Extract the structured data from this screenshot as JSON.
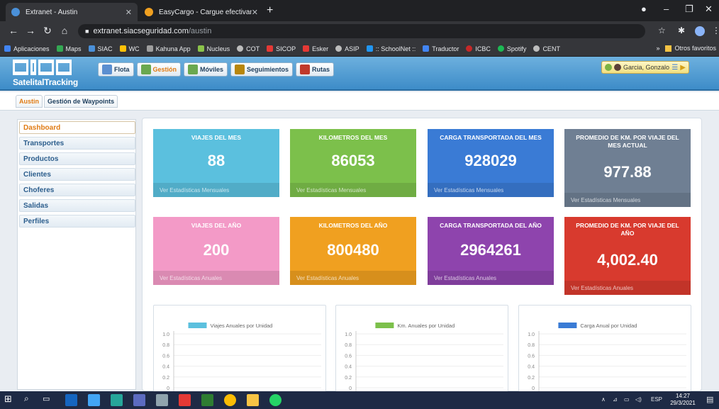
{
  "browser": {
    "tabs": [
      {
        "label": "Extranet - Austin",
        "active": true
      },
      {
        "label": "EasyCargo - Cargue efectivamen",
        "active": false
      }
    ],
    "url_host": "extranet.siacseguridad.com",
    "url_path": "/austin",
    "bookmarks": [
      "Aplicaciones",
      "Maps",
      "SIAC",
      "WC",
      "Kahuna App",
      "Nucleus",
      "COT",
      "SICOP",
      "Esker",
      "ASIP",
      ":: SchoolNet ::",
      "Traductor",
      "ICBC",
      "Spotify",
      "CENT"
    ],
    "bookmarks_more": "»",
    "other_bookmarks": "Otros favoritos"
  },
  "app": {
    "logo_tagline": "SatelitalTracking",
    "menu": [
      {
        "label": "Flota",
        "active": false,
        "color": "#5b8fd0"
      },
      {
        "label": "Gestión",
        "active": true,
        "color": "#6aa84f"
      },
      {
        "label": "Móviles",
        "active": false,
        "color": "#6aa84f"
      },
      {
        "label": "Seguimientos",
        "active": false,
        "color": "#b8860b"
      },
      {
        "label": "Rutas",
        "active": false,
        "color": "#c0392b"
      }
    ],
    "user_name": "Garcia, Gonzalo"
  },
  "subtabs": [
    {
      "label": "Austin",
      "active": true
    },
    {
      "label": "Gestión de Waypoints",
      "active": false
    }
  ],
  "sidebar": {
    "items": [
      {
        "label": "Dashboard",
        "active": true
      },
      {
        "label": "Transportes",
        "active": false
      },
      {
        "label": "Productos",
        "active": false
      },
      {
        "label": "Clientes",
        "active": false
      },
      {
        "label": "Choferes",
        "active": false
      },
      {
        "label": "Salidas",
        "active": false
      },
      {
        "label": "Perfiles",
        "active": false
      }
    ]
  },
  "cards": [
    {
      "title": "VIAJES DEL MES",
      "value": "88",
      "footer": "Ver Estadísticas Mensuales",
      "color": "#5bc0de"
    },
    {
      "title": "KILOMETROS DEL MES",
      "value": "86053",
      "footer": "Ver Estadísticas Mensuales",
      "color": "#7cc04b"
    },
    {
      "title": "CARGA TRANSPORTADA DEL MES",
      "value": "928029",
      "footer": "Ver Estadísticas Mensuales",
      "color": "#3a7bd5"
    },
    {
      "title": "PROMEDIO DE KM. POR VIAJE DEL MES ACTUAL",
      "value": "977.88",
      "footer": "Ver Estadísticas Mensuales",
      "color": "#6f7f93"
    },
    {
      "title": "VIAJES DEL AÑO",
      "value": "200",
      "footer": "Ver Estadísticas Anuales",
      "color": "#f39ac7"
    },
    {
      "title": "KILOMETROS DEL AÑO",
      "value": "800480",
      "footer": "Ver Estadísticas Anuales",
      "color": "#f0a020"
    },
    {
      "title": "CARGA TRANSPORTADA DEL AÑO",
      "value": "2964261",
      "footer": "Ver Estadísticas Anuales",
      "color": "#8e44ad"
    },
    {
      "title": "PROMEDIO DE KM. POR VIAJE DEL AÑO",
      "value": "4,002.40",
      "footer": "Ver Estadísticas Anuales",
      "color": "#d83a2e"
    }
  ],
  "chart_data": [
    {
      "type": "bar",
      "legend": "Viajes Anuales por Unidad",
      "color": "#5bc0de",
      "categories": [],
      "values": [],
      "yticks": [
        "1.0",
        "0.8",
        "0.6",
        "0.4",
        "0.2",
        "0"
      ],
      "ylim": [
        0,
        1.0
      ],
      "grid": true,
      "legend_position": "top"
    },
    {
      "type": "bar",
      "legend": "Km. Anuales por Unidad",
      "color": "#7cc04b",
      "categories": [],
      "values": [],
      "yticks": [
        "1.0",
        "0.8",
        "0.6",
        "0.4",
        "0.2",
        "0"
      ],
      "ylim": [
        0,
        1.0
      ],
      "grid": true,
      "legend_position": "top"
    },
    {
      "type": "bar",
      "legend": "Carga Anual por Unidad",
      "color": "#3a7bd5",
      "categories": [],
      "values": [],
      "yticks": [
        "1.0",
        "0.8",
        "0.6",
        "0.4",
        "0.2",
        "0"
      ],
      "ylim": [
        0,
        1.0
      ],
      "grid": true,
      "legend_position": "top"
    }
  ],
  "taskbar": {
    "language": "ESP",
    "time": "14:27",
    "date": "29/3/2021"
  }
}
